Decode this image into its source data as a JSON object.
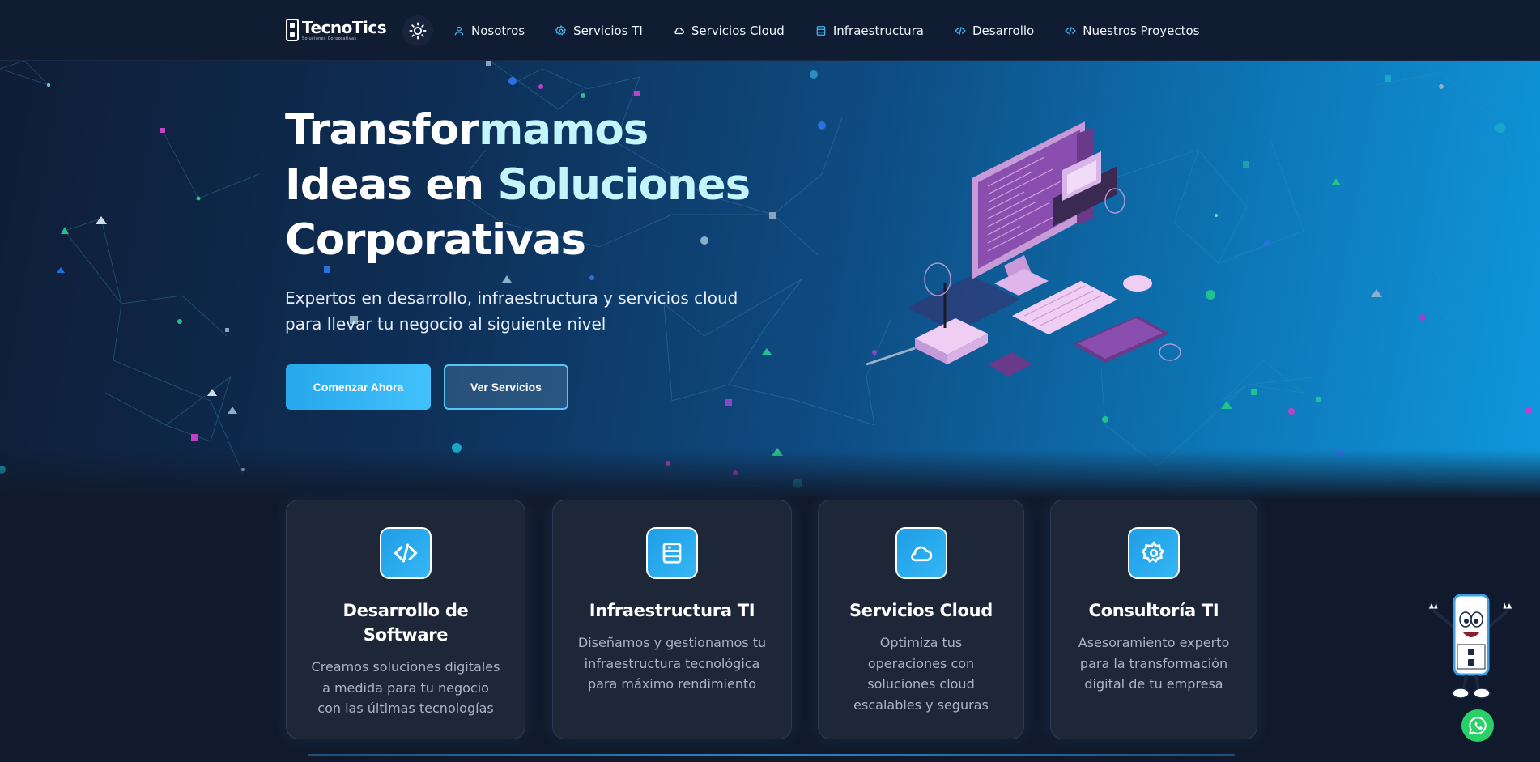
{
  "brand": {
    "name": "TecnoTics",
    "tagline": "Soluciones Corporativas"
  },
  "nav": {
    "items": [
      {
        "label": "Nosotros",
        "icon": "user-icon"
      },
      {
        "label": "Servicios TI",
        "icon": "gear-icon"
      },
      {
        "label": "Servicios Cloud",
        "icon": "cloud-icon"
      },
      {
        "label": "Infraestructura",
        "icon": "server-icon"
      },
      {
        "label": "Desarrollo",
        "icon": "code-icon"
      },
      {
        "label": "Nuestros Proyectos",
        "icon": "code-icon"
      }
    ],
    "theme_toggle_icon": "sun-icon"
  },
  "hero": {
    "title_line1a": "Transfor",
    "title_line1b": "mamos",
    "title_line2a": "Ideas en ",
    "title_line2b": "Soluciones",
    "title_line3": "Corporativas",
    "subtitle": "Expertos en desarrollo, infraestructura y servicios cloud para llevar tu negocio al siguiente nivel",
    "primary_button": "Comenzar Ahora",
    "secondary_button": "Ver Servicios"
  },
  "services": [
    {
      "title": "Desarrollo de Software",
      "description": "Creamos soluciones digitales a medida para tu negocio con las últimas tecnologías",
      "icon": "code-icon"
    },
    {
      "title": "Infraestructura TI",
      "description": "Diseñamos y gestionamos tu infraestructura tecnológica para máximo rendimiento",
      "icon": "server-icon"
    },
    {
      "title": "Servicios Cloud",
      "description": "Optimiza tus operaciones con soluciones cloud escalables y seguras",
      "icon": "cloud-icon"
    },
    {
      "title": "Consultoría TI",
      "description": "Asesoramiento experto para la transformación digital de tu empresa",
      "icon": "gear-icon"
    }
  ],
  "colors": {
    "accent": "#26a7ec",
    "navbar": "#101c31",
    "page_bg": "#111a2c",
    "card_bg": "#1d2738",
    "whatsapp": "#29cf67"
  }
}
